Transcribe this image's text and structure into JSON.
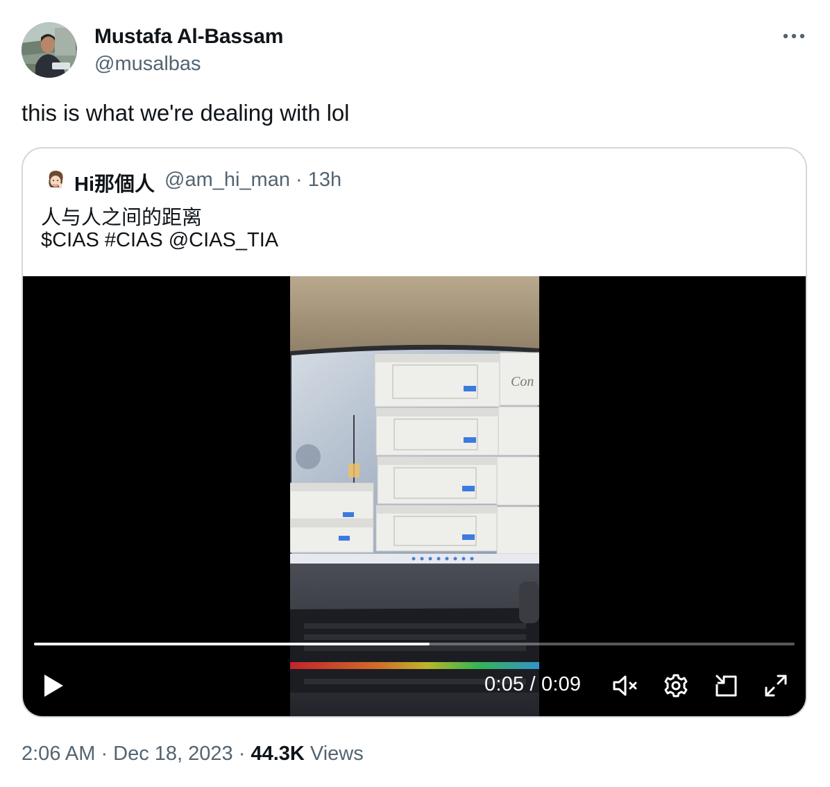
{
  "author": {
    "name": "Mustafa Al-Bassam",
    "handle": "@musalbas",
    "avatar_icon": "user-avatar-icon"
  },
  "tweet": {
    "text": "this is what we're dealing with lol"
  },
  "quoted": {
    "name": "Hi那個人",
    "meta": "@am_hi_man · 13h",
    "line1": "人与人之间的距离",
    "line2": "$CIAS #CIAS @CIAS_TIA"
  },
  "video": {
    "screen_text": "Con",
    "time": "0:05 / 0:09",
    "progress": 0.52,
    "icons": {
      "play": "play-icon",
      "mute": "muted-speaker-icon",
      "settings": "gear-icon",
      "pip": "picture-in-picture-icon",
      "fullscreen": "fullscreen-icon"
    }
  },
  "footer": {
    "time_date": "2:06 AM · Dec 18, 2023 · ",
    "views_count": "44.3K",
    "views_label": " Views"
  },
  "colors": {
    "text": "#0f1419",
    "secondary": "#536471",
    "border": "#cfd9de"
  }
}
